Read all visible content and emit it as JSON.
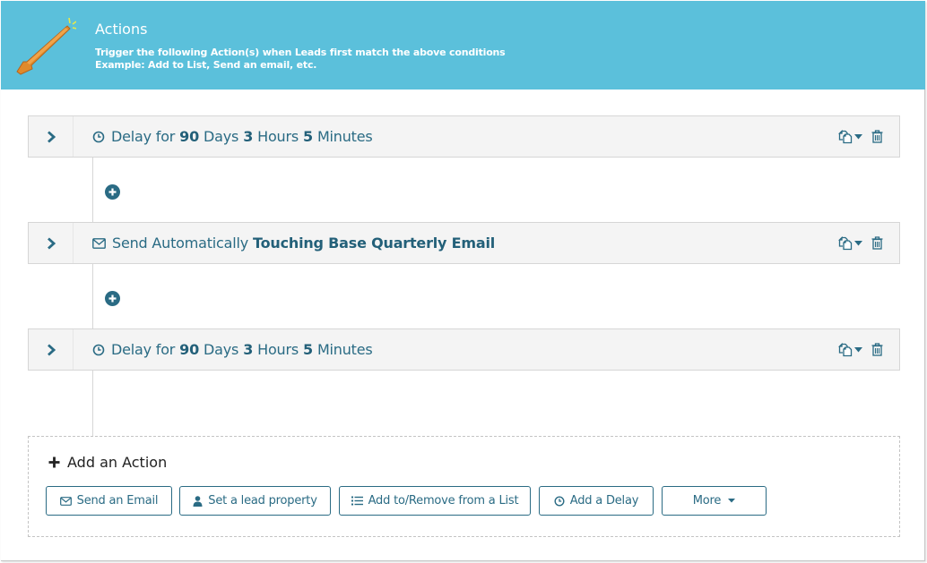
{
  "header": {
    "title": "Actions",
    "description_line1": "Trigger the following Action(s) when Leads first match the above conditions",
    "description_line2": "Example: Add to List, Send an email, etc.",
    "icon": "magic-wand-icon",
    "background_color": "#5bc0db"
  },
  "actions": [
    {
      "type": "delay",
      "icon": "clock-icon",
      "parts": [
        {
          "text": "Delay for",
          "bold": false
        },
        {
          "text": "90",
          "bold": true
        },
        {
          "text": "Days",
          "bold": false
        },
        {
          "text": "3",
          "bold": true
        },
        {
          "text": "Hours",
          "bold": false
        },
        {
          "text": "5",
          "bold": true
        },
        {
          "text": "Minutes",
          "bold": false
        }
      ]
    },
    {
      "type": "email",
      "icon": "envelope-icon",
      "parts": [
        {
          "text": "Send Automatically",
          "bold": false
        },
        {
          "text": "Touching Base Quarterly Email",
          "bold": true
        }
      ]
    },
    {
      "type": "delay",
      "icon": "clock-icon",
      "parts": [
        {
          "text": "Delay for",
          "bold": false
        },
        {
          "text": "90",
          "bold": true
        },
        {
          "text": "Days",
          "bold": false
        },
        {
          "text": "3",
          "bold": true
        },
        {
          "text": "Hours",
          "bold": false
        },
        {
          "text": "5",
          "bold": true
        },
        {
          "text": "Minutes",
          "bold": false
        }
      ]
    }
  ],
  "add_action": {
    "title": "Add an Action",
    "buttons": [
      {
        "label": "Send an Email",
        "icon": "envelope-icon"
      },
      {
        "label": "Set a lead property",
        "icon": "user-icon"
      },
      {
        "label": "Add to/Remove from a List",
        "icon": "list-icon"
      },
      {
        "label": "Add a Delay",
        "icon": "clock-icon"
      },
      {
        "label": "More",
        "icon": "caret-down-icon"
      }
    ]
  },
  "colors": {
    "primary": "#2a6b84",
    "row_background": "#f4f4f4"
  }
}
